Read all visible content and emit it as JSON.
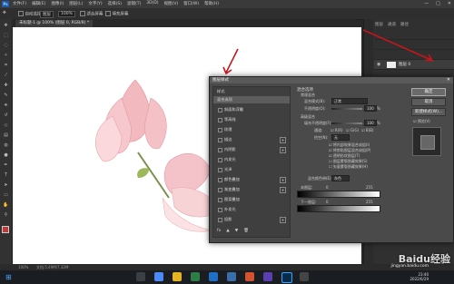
{
  "menubar": {
    "app_logo": "Ps",
    "menus": [
      "文件(F)",
      "编辑(E)",
      "图像(I)",
      "图层(L)",
      "文字(Y)",
      "选择(S)",
      "滤镜(T)",
      "3D(D)",
      "视图(V)",
      "窗口(W)",
      "帮助(H)"
    ],
    "window_controls": [
      "—",
      "□",
      "✕"
    ]
  },
  "optionsbar": {
    "auto_select_label": "自动选择",
    "auto_select_target": "图层",
    "zoom_value": "100%",
    "fit_screen": "适合屏幕",
    "fill_screen": "填充屏幕"
  },
  "tab": {
    "label": "未标题-1 @ 100% (图层 0, RGB/8) *"
  },
  "tools": [
    "move-tool",
    "marquee-tool",
    "lasso-tool",
    "magic-wand-tool",
    "crop-tool",
    "eyedropper-tool",
    "healing-tool",
    "brush-tool",
    "stamp-tool",
    "history-brush-tool",
    "eraser-tool",
    "gradient-tool",
    "blur-tool",
    "dodge-tool",
    "pen-tool",
    "type-tool",
    "path-select-tool",
    "shape-tool",
    "hand-tool",
    "zoom-tool"
  ],
  "dialog": {
    "title": "图层样式",
    "close": "✕",
    "styles_header": "样式",
    "style_items": [
      {
        "label": "混合选项",
        "checkbox": false,
        "plus": false,
        "selected": true
      },
      {
        "label": "斜面和浮雕",
        "checkbox": true,
        "plus": false,
        "selected": false
      },
      {
        "label": "等高线",
        "checkbox": true,
        "plus": false,
        "selected": false
      },
      {
        "label": "纹理",
        "checkbox": true,
        "plus": false,
        "selected": false
      },
      {
        "label": "描边",
        "checkbox": true,
        "plus": true,
        "selected": false
      },
      {
        "label": "内阴影",
        "checkbox": true,
        "plus": true,
        "selected": false
      },
      {
        "label": "内发光",
        "checkbox": true,
        "plus": false,
        "selected": false
      },
      {
        "label": "光泽",
        "checkbox": true,
        "plus": false,
        "selected": false
      },
      {
        "label": "颜色叠加",
        "checkbox": true,
        "plus": true,
        "selected": false
      },
      {
        "label": "渐变叠加",
        "checkbox": true,
        "plus": true,
        "selected": false
      },
      {
        "label": "图案叠加",
        "checkbox": true,
        "plus": false,
        "selected": false
      },
      {
        "label": "外发光",
        "checkbox": true,
        "plus": false,
        "selected": false
      },
      {
        "label": "投影",
        "checkbox": true,
        "plus": true,
        "selected": false
      }
    ],
    "footer_icons": [
      "fx",
      "▲",
      "▼",
      "🗑"
    ],
    "blend_options_title": "混合选项",
    "general_blend_title": "常规混合",
    "blend_mode_label": "混合模式(B):",
    "blend_mode_value": "正常",
    "opacity_label": "不透明度(O):",
    "opacity_value": "100",
    "advanced_blend_title": "高级混合",
    "fill_opacity_label": "填充不透明度(F):",
    "fill_opacity_value": "100",
    "channels_label": "通道:",
    "channels": [
      "R(R)",
      "G(G)",
      "B(B)"
    ],
    "knockout_label": "挖空(N):",
    "knockout_value": "无",
    "advanced_options": [
      "将内部效果混合成组(I)",
      "将剪贴图层混合成组(P)",
      "透明形状图层(T)",
      "图层蒙版隐藏效果(S)",
      "矢量蒙版隐藏效果(H)"
    ],
    "blend_if_label": "混合颜色带(E):",
    "blend_if_value": "灰色",
    "this_layer_label": "本图层:",
    "this_layer_min": "0",
    "this_layer_max": "255",
    "underlying_label": "下一图层:",
    "underlying_min": "0",
    "underlying_max": "255",
    "ok_button": "确定",
    "cancel_button": "取消",
    "new_style_button": "新建样式(W)...",
    "preview_label": "预览(V)",
    "percent": "%"
  },
  "panels": {
    "tabs": [
      "图层",
      "通道",
      "路径"
    ],
    "layer_name": "图层 0"
  },
  "status": {
    "zoom": "100%",
    "doc_info": "文档:5.49M/7.32M"
  },
  "taskbar": {
    "time": "23:40",
    "date": "2022/6/29"
  },
  "watermark": {
    "text": "Baidu经验",
    "url": "jingyan.baidu.com"
  }
}
